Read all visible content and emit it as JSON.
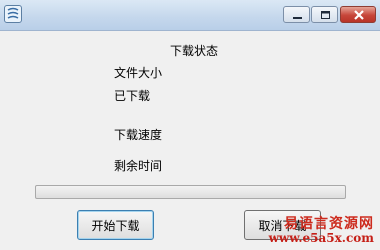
{
  "window": {
    "title": ""
  },
  "status": {
    "heading": "下载状态",
    "file_size_label": "文件大小",
    "downloaded_label": "已下载",
    "speed_label": "下载速度",
    "remaining_label": "剩余时间"
  },
  "progress": {
    "value": 0
  },
  "buttons": {
    "start": "开始下载",
    "cancel": "取消下载"
  },
  "watermark": {
    "text": "易语言资源网",
    "url": "www.e5a5x.com"
  },
  "colors": {
    "titlebar": "#c4d7ec",
    "close_button": "#c7463a",
    "watermark": "#cd2b1e"
  }
}
